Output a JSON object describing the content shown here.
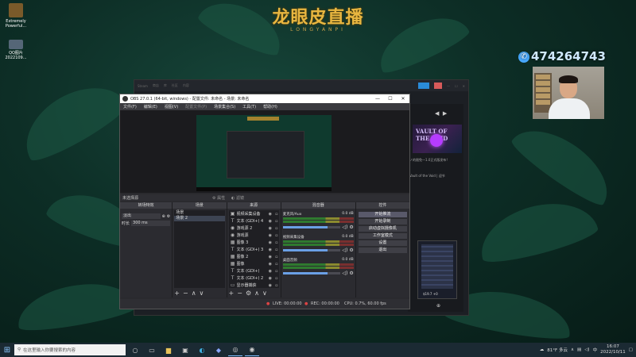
{
  "brand": {
    "title": "龙眼皮直播",
    "subtitle": "LONGYANPI"
  },
  "desktop_icons": [
    {
      "label": "Extremely Powerful...",
      "color": "#7a5a2a"
    },
    {
      "label": "QQ图片 2022109...",
      "color": "#556677"
    }
  ],
  "qq_number": "474264743",
  "back_app": {
    "game_title": "VAULT OF THE VOID",
    "rp_line1": "ノ的限免一1.0正式版发布!",
    "rp_line2": "Vault of the Void | 迎节",
    "card_price": "$19.7 +0"
  },
  "obs": {
    "title": "OBS 27.0.1 (64-bit, windows) - 配置文件: 未命名 - 场景: 未命名",
    "menu": [
      "文件(F)",
      "编辑(E)",
      "视图(V)",
      "配置文件(P)",
      "场景集合(S)",
      "工具(T)",
      "帮助(H)"
    ],
    "window_buttons": [
      "—",
      "☐",
      "✕"
    ],
    "current_scene": "未选择源",
    "props_label": "属性",
    "filters_label": "滤镜",
    "docks": {
      "transitions": {
        "header": "转场特效",
        "fade": "淡出",
        "duration_label": "时长",
        "duration_value": "300 ms"
      },
      "scenes": {
        "header": "场景",
        "items": [
          "场景",
          "场景 2"
        ]
      },
      "sources": {
        "header": "来源",
        "items": [
          {
            "icon": "▣",
            "icon_name": "video-capture-icon",
            "label": "视频采集设备"
          },
          {
            "icon": "T",
            "icon_name": "text-icon",
            "label": "文本 (GDI+) 4"
          },
          {
            "icon": "◉",
            "icon_name": "game-capture-icon",
            "label": "游戏源 2"
          },
          {
            "icon": "◉",
            "icon_name": "game-capture-icon",
            "label": "游戏源"
          },
          {
            "icon": "▦",
            "icon_name": "image-icon",
            "label": "图像 3"
          },
          {
            "icon": "T",
            "icon_name": "text-icon",
            "label": "文本 (GDI+) 3"
          },
          {
            "icon": "▦",
            "icon_name": "image-icon",
            "label": "图像 2"
          },
          {
            "icon": "▦",
            "icon_name": "image-icon",
            "label": "图像"
          },
          {
            "icon": "T",
            "icon_name": "text-icon",
            "label": "文本 (GDI+)"
          },
          {
            "icon": "T",
            "icon_name": "text-icon",
            "label": "文本 (GDI+) 2"
          },
          {
            "icon": "▭",
            "icon_name": "display-capture-icon",
            "label": "显示器捕获"
          }
        ]
      },
      "mixer": {
        "header": "混音器",
        "channels": [
          {
            "name": "麦克风/Aux",
            "db": "0.0 dB",
            "level": 0.78
          },
          {
            "name": "视频采集设备",
            "db": "0.0 dB",
            "level": 0.78
          },
          {
            "name": "桌面音频",
            "db": "0.0 dB",
            "level": 0.78
          }
        ]
      },
      "controls": {
        "header": "控件",
        "buttons": [
          "开始推流",
          "开始录制",
          "启动虚拟摄像机",
          "工作室模式",
          "设置",
          "退出"
        ]
      }
    },
    "status": {
      "live": "LIVE: 00:00:00",
      "rec": "REC: 00:00:00",
      "cpu": "CPU: 0.7%, 60.00 fps"
    }
  },
  "taskbar": {
    "search_placeholder": "在这里输入你要搜索的内容",
    "weather": "81°F 多云",
    "ime": "中",
    "time": "16:07",
    "date": "2022/10/11"
  }
}
